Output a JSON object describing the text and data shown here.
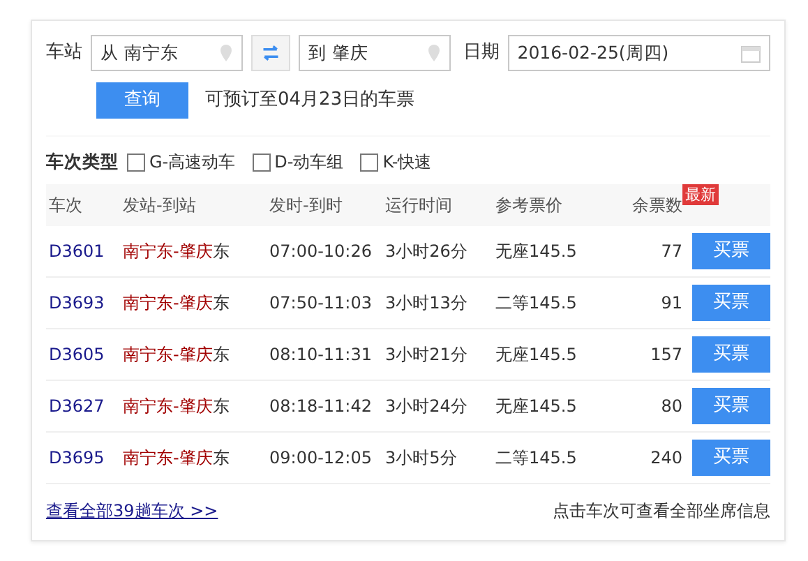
{
  "search": {
    "station_label": "车站",
    "from": "从 南宁东",
    "to": "到 肇庆",
    "date_label": "日期",
    "date": "2016-02-25(周四)",
    "query_button": "查询",
    "booking_note": "可预订至04月23日的车票"
  },
  "filter": {
    "label": "车次类型",
    "options": [
      {
        "label": "G-高速动车",
        "checked": false
      },
      {
        "label": "D-动车组",
        "checked": false
      },
      {
        "label": "K-快速",
        "checked": false
      }
    ]
  },
  "table": {
    "columns": [
      "车次",
      "发站-到站",
      "发时-到时",
      "运行时间",
      "参考票价",
      "余票数"
    ],
    "new_badge": "最新",
    "rows": [
      {
        "train": "D3601",
        "route_match": "南宁东-肇庆",
        "route_rest": "东",
        "times": "07:00-10:26",
        "duration": "3小时26分",
        "price": "无座145.5",
        "remaining": "77",
        "action": "买票"
      },
      {
        "train": "D3693",
        "route_match": "南宁东-肇庆",
        "route_rest": "东",
        "times": "07:50-11:03",
        "duration": "3小时13分",
        "price": "二等145.5",
        "remaining": "91",
        "action": "买票"
      },
      {
        "train": "D3605",
        "route_match": "南宁东-肇庆",
        "route_rest": "东",
        "times": "08:10-11:31",
        "duration": "3小时21分",
        "price": "无座145.5",
        "remaining": "157",
        "action": "买票"
      },
      {
        "train": "D3627",
        "route_match": "南宁东-肇庆",
        "route_rest": "东",
        "times": "08:18-11:42",
        "duration": "3小时24分",
        "price": "无座145.5",
        "remaining": "80",
        "action": "买票"
      },
      {
        "train": "D3695",
        "route_match": "南宁东-肇庆",
        "route_rest": "东",
        "times": "09:00-12:05",
        "duration": "3小时5分",
        "price": "二等145.5",
        "remaining": "240",
        "action": "买票"
      }
    ]
  },
  "footer": {
    "all_link": "查看全部39趟车次 >>",
    "hint": "点击车次可查看全部坐席信息"
  }
}
